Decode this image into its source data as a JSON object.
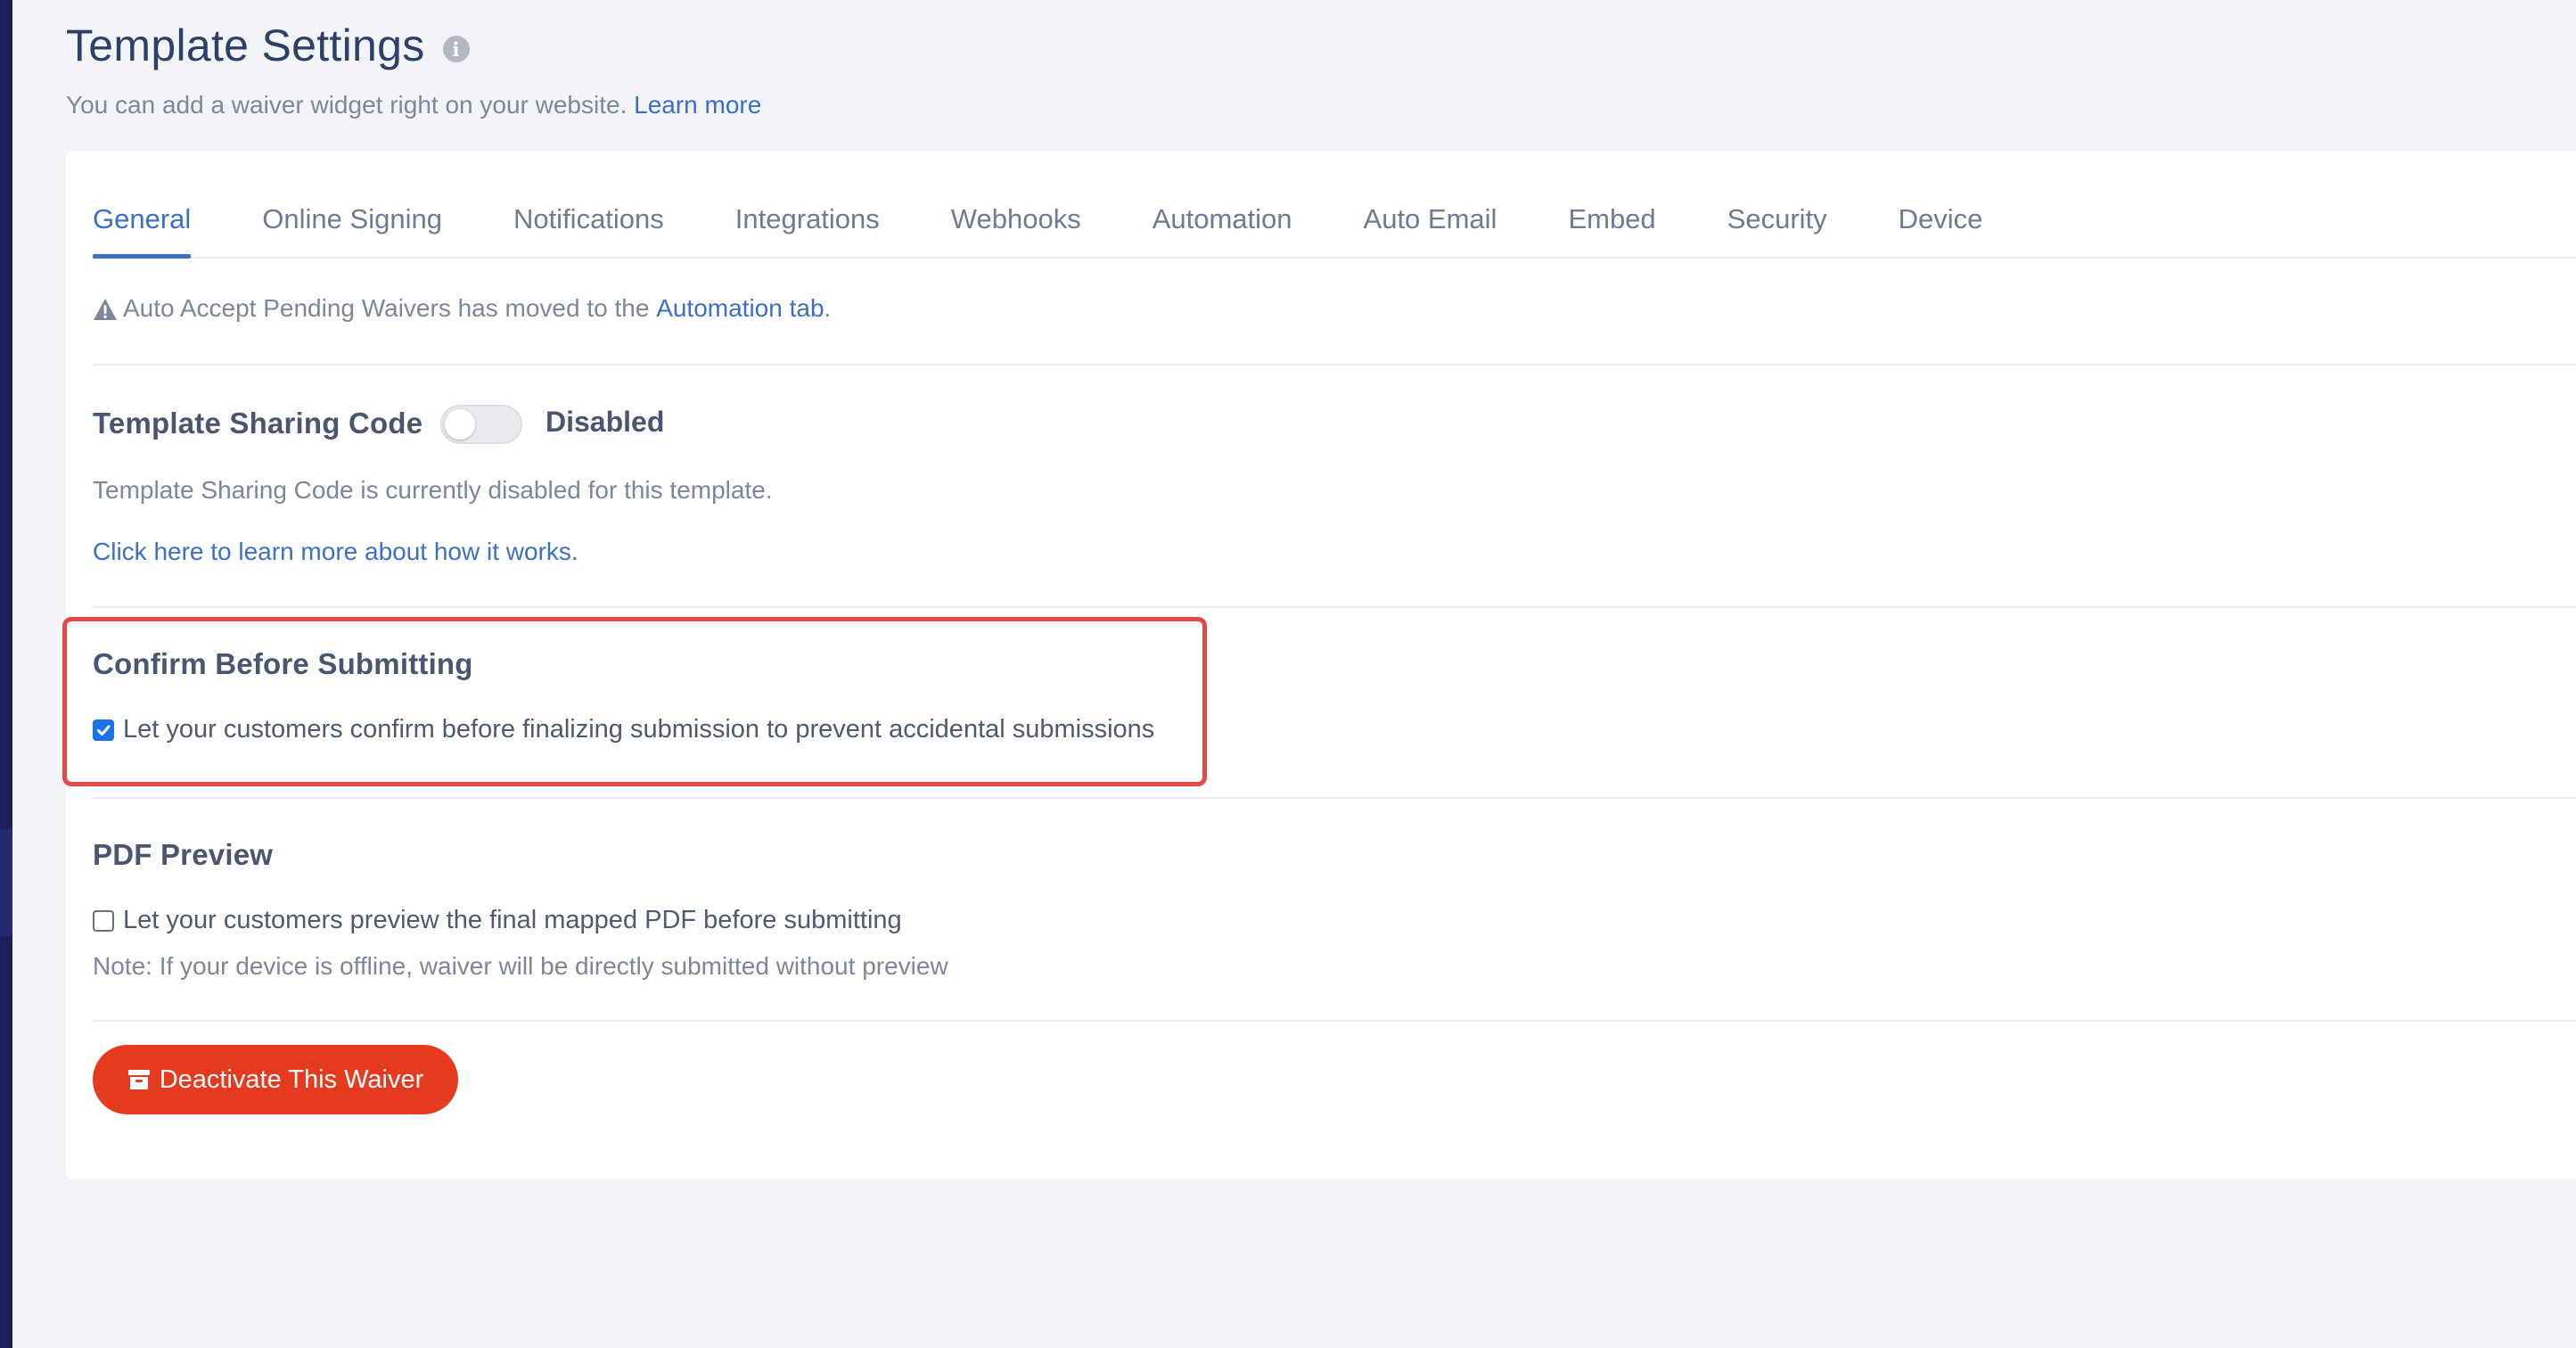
{
  "header": {
    "title": "Template Settings",
    "subtitle": "You can add a waiver widget right on your website.",
    "learn_more": "Learn more"
  },
  "tabs": [
    {
      "label": "General",
      "active": true
    },
    {
      "label": "Online Signing",
      "active": false
    },
    {
      "label": "Notifications",
      "active": false
    },
    {
      "label": "Integrations",
      "active": false
    },
    {
      "label": "Webhooks",
      "active": false
    },
    {
      "label": "Automation",
      "active": false
    },
    {
      "label": "Auto Email",
      "active": false
    },
    {
      "label": "Embed",
      "active": false
    },
    {
      "label": "Security",
      "active": false
    },
    {
      "label": "Device",
      "active": false
    }
  ],
  "notice": {
    "text": "Auto Accept Pending Waivers has moved to the",
    "link": "Automation tab",
    "suffix": "."
  },
  "sharing": {
    "label": "Template Sharing Code",
    "toggle_on": false,
    "state": "Disabled",
    "description": "Template Sharing Code is currently disabled for this template.",
    "link": "Click here to learn more about how it works."
  },
  "confirm": {
    "label": "Confirm Before Submitting",
    "checked": true,
    "option": "Let your customers confirm before finalizing submission to prevent accidental submissions"
  },
  "pdf_preview": {
    "label": "PDF Preview",
    "checked": false,
    "option": "Let your customers preview the final mapped PDF before submitting",
    "note": "Note: If your device is offline, waiver will be directly submitted without preview"
  },
  "actions": {
    "deactivate_label": "Deactivate This Waiver"
  },
  "colors": {
    "accent": "#3d6fc4",
    "danger": "#e63a1f",
    "highlight": "#e5484a",
    "checkbox": "#1a73e8"
  }
}
